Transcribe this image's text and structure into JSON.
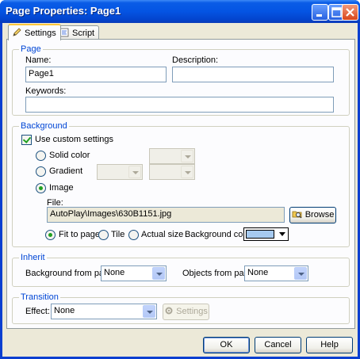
{
  "window": {
    "title": "Page Properties: Page1"
  },
  "tabs": [
    {
      "label": "Settings",
      "icon": "pencil-icon"
    },
    {
      "label": "Script",
      "icon": "script-icon"
    }
  ],
  "page_group": {
    "legend": "Page",
    "name_label": "Name:",
    "name_value": "Page1",
    "description_label": "Description:",
    "description_value": "",
    "keywords_label": "Keywords:",
    "keywords_value": ""
  },
  "background_group": {
    "legend": "Background",
    "use_custom_label": "Use custom settings",
    "use_custom_checked": true,
    "solid_color_label": "Solid color",
    "gradient_label": "Gradient",
    "image_label": "Image",
    "selected_mode": "Image",
    "file_label": "File:",
    "file_value": "AutoPlay\\Images\\630B1151.jpg",
    "browse_label": "Browse",
    "fit_to_page_label": "Fit to page",
    "tile_label": "Tile",
    "actual_size_label": "Actual size",
    "selected_fit": "Fit to page",
    "background_color_label": "Background color:",
    "background_color_value": "#a6caf0"
  },
  "inherit_group": {
    "legend": "Inherit",
    "background_from_label": "Background from page:",
    "background_from_value": "None",
    "objects_from_label": "Objects from page:",
    "objects_from_value": "None"
  },
  "transition_group": {
    "legend": "Transition",
    "effect_label": "Effect:",
    "effect_value": "None",
    "settings_label": "Settings"
  },
  "footer": {
    "ok_label": "OK",
    "cancel_label": "Cancel",
    "help_label": "Help"
  },
  "colors": {
    "titlebar": "#0454e3",
    "dialog_bg": "#ece9d8",
    "group_legend": "#0046d5"
  }
}
